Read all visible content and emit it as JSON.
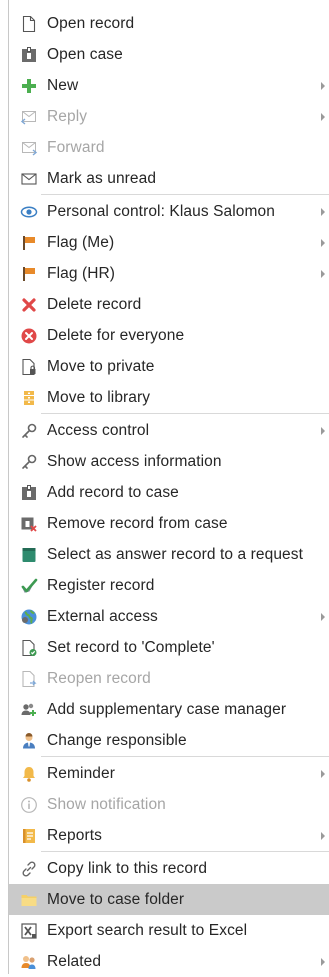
{
  "menu": {
    "items": [
      {
        "label": "Open record",
        "icon": "document-icon"
      },
      {
        "label": "Open case",
        "icon": "case-icon"
      },
      {
        "label": "New",
        "icon": "plus-icon",
        "submenu": true
      },
      {
        "label": "Reply",
        "icon": "reply-icon",
        "submenu": true,
        "disabled": true
      },
      {
        "label": "Forward",
        "icon": "forward-icon",
        "disabled": true
      },
      {
        "label": "Mark as unread",
        "icon": "envelope-icon"
      },
      {
        "label": "Personal control: Klaus Salomon",
        "icon": "eye-icon",
        "submenu": true
      },
      {
        "label": "Flag (Me)",
        "icon": "flag-icon",
        "submenu": true
      },
      {
        "label": "Flag (HR)",
        "icon": "flag-icon",
        "submenu": true
      },
      {
        "label": "Delete record",
        "icon": "delete-x-icon"
      },
      {
        "label": "Delete for everyone",
        "icon": "delete-circle-icon"
      },
      {
        "label": "Move to private",
        "icon": "private-document-icon"
      },
      {
        "label": "Move to library",
        "icon": "library-icon"
      },
      {
        "label": "Access control",
        "icon": "key-icon",
        "submenu": true
      },
      {
        "label": "Show access information",
        "icon": "key-icon"
      },
      {
        "label": "Add record to case",
        "icon": "case-add-icon"
      },
      {
        "label": "Remove record from case",
        "icon": "case-remove-icon"
      },
      {
        "label": "Select as answer record to a request",
        "icon": "answer-record-icon"
      },
      {
        "label": "Register record",
        "icon": "register-check-icon"
      },
      {
        "label": "External access",
        "icon": "globe-icon",
        "submenu": true
      },
      {
        "label": "Set record to 'Complete'",
        "icon": "complete-document-icon"
      },
      {
        "label": "Reopen record",
        "icon": "reopen-document-icon",
        "disabled": true
      },
      {
        "label": "Add supplementary case manager",
        "icon": "add-users-icon"
      },
      {
        "label": "Change responsible",
        "icon": "person-icon"
      },
      {
        "label": "Reminder",
        "icon": "bell-icon",
        "submenu": true
      },
      {
        "label": "Show notification",
        "icon": "info-icon",
        "disabled": true
      },
      {
        "label": "Reports",
        "icon": "report-icon",
        "submenu": true
      },
      {
        "label": "Copy link to this record",
        "icon": "link-icon"
      },
      {
        "label": "Move to case folder",
        "icon": "folder-icon",
        "highlighted": true
      },
      {
        "label": "Export search result to Excel",
        "icon": "excel-icon"
      },
      {
        "label": "Related",
        "icon": "related-people-icon",
        "submenu": true
      }
    ]
  },
  "colors": {
    "accent_green": "#4caf50",
    "flag_orange": "#e88a2a",
    "delete_red": "#e04848",
    "highlight_gray": "#cacaca",
    "disabled_text": "#a6a6a6"
  }
}
